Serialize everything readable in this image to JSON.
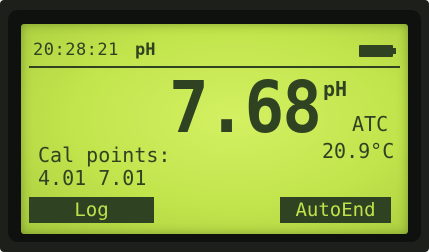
{
  "status": {
    "time": "20:28:21",
    "mode_unit": "pH",
    "battery_icon": "battery-full-icon"
  },
  "reading": {
    "value": "7.68",
    "unit": "pH",
    "compensation": "ATC",
    "temperature": "20.9°C"
  },
  "calibration": {
    "label": "Cal points:",
    "points": "4.01 7.01"
  },
  "softkeys": {
    "left_label": "Log",
    "right_label": "AutoEnd"
  },
  "colors": {
    "lcd_background": "#c4e84f",
    "lcd_text": "#2f4222",
    "bezel": "#1c1f1a"
  }
}
